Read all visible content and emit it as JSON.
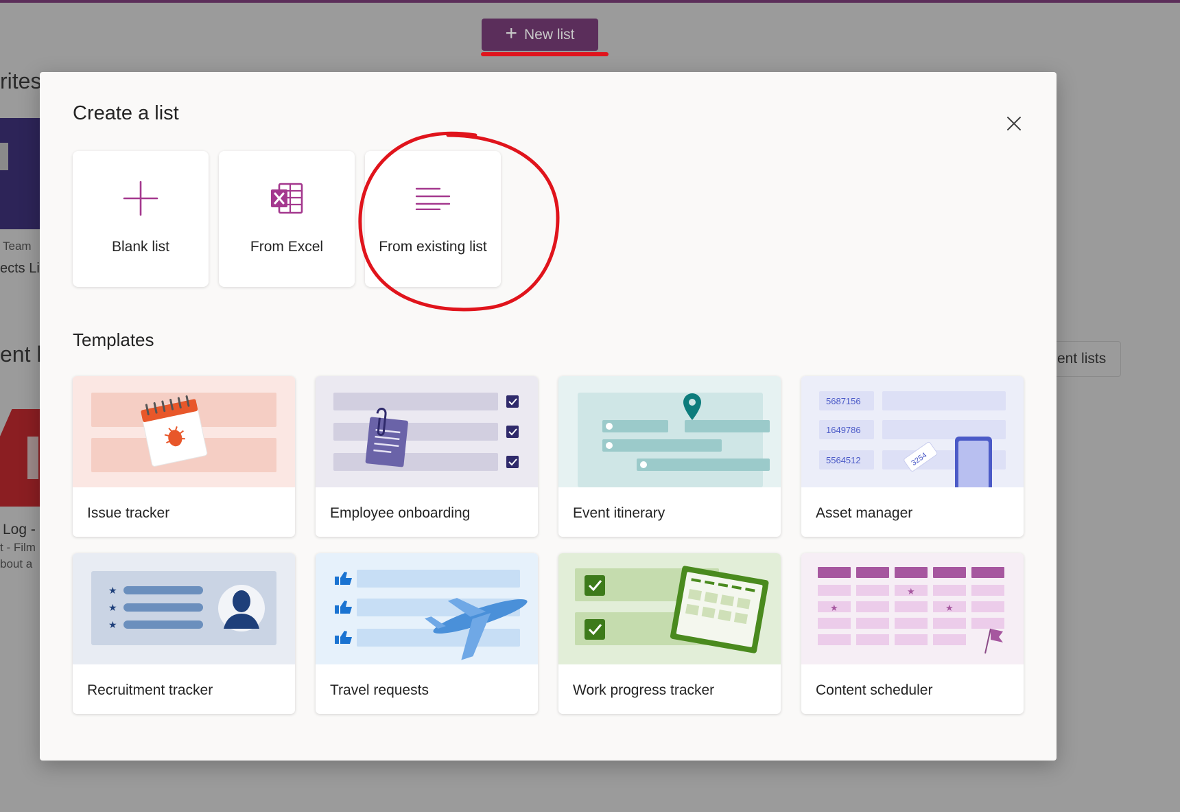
{
  "background": {
    "new_list_label": "New list",
    "favorites_heading": "rites",
    "team_label": "Team",
    "projects_label": "ects Lis",
    "recent_heading": "ent lis",
    "recent_lists_button": "ent lists",
    "log_title": "Log -",
    "film_line": "t - Film",
    "about_line": "bout a"
  },
  "modal": {
    "title": "Create a list",
    "close_icon": "close-icon",
    "options": [
      {
        "label": "Blank list",
        "icon": "plus-icon"
      },
      {
        "label": "From Excel",
        "icon": "excel-icon"
      },
      {
        "label": "From existing list",
        "icon": "list-lines-icon"
      }
    ],
    "templates_heading": "Templates",
    "templates": [
      {
        "label": "Issue tracker"
      },
      {
        "label": "Employee onboarding"
      },
      {
        "label": "Event itinerary"
      },
      {
        "label": "Asset manager",
        "art_numbers": [
          "5687156",
          "1649786",
          "5564512"
        ],
        "art_tag": "3254"
      },
      {
        "label": "Recruitment tracker"
      },
      {
        "label": "Travel requests"
      },
      {
        "label": "Work progress tracker"
      },
      {
        "label": "Content scheduler"
      }
    ]
  },
  "colors": {
    "accent_purple": "#5b2e5b",
    "icon_purple": "#a4388e",
    "annotation_red": "#e0141c"
  }
}
